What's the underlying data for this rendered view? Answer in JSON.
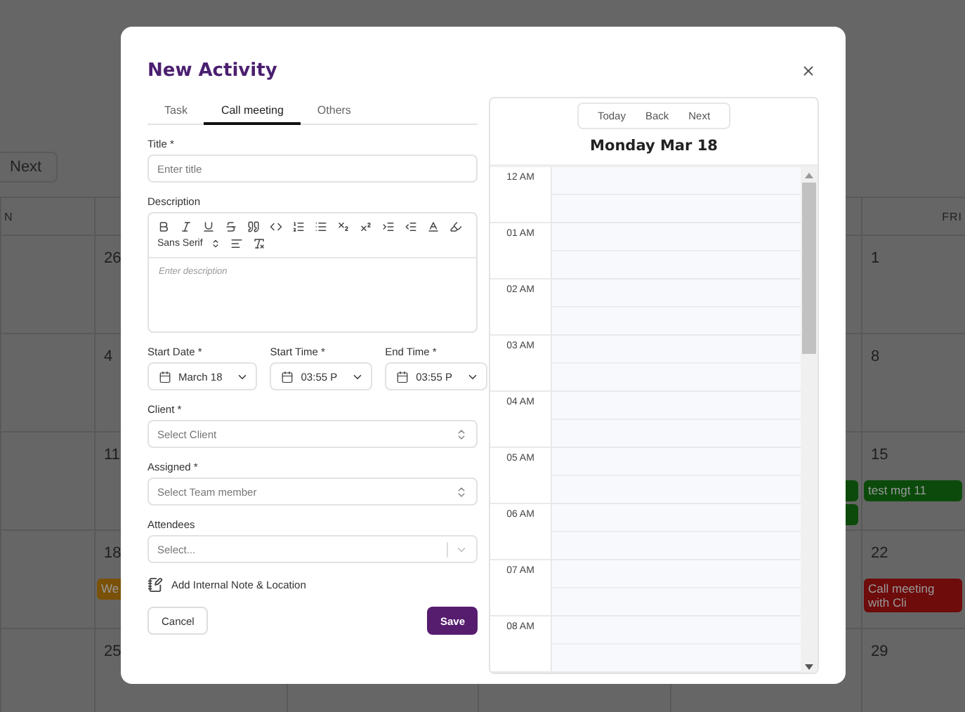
{
  "background_calendar": {
    "nav_button": "Next",
    "columns": [
      {
        "kind": "header_only",
        "header": "N"
      },
      {
        "kind": "days",
        "days": [
          {
            "kind": "day",
            "date": "26"
          },
          {
            "kind": "day",
            "date": "4"
          },
          {
            "kind": "day",
            "date": "11"
          },
          {
            "kind": "day",
            "date": "18",
            "events": [
              {
                "title": "We",
                "color": "#7a5108"
              }
            ]
          },
          {
            "kind": "day",
            "date": "25"
          }
        ]
      },
      {
        "kind": "covered"
      },
      {
        "kind": "covered"
      },
      {
        "kind": "days",
        "days": [
          {
            "kind": "blank"
          },
          {
            "kind": "blank"
          },
          {
            "kind": "day",
            "events": [
              {
                "color": "#0b4a0b"
              },
              {
                "color": "#0b4a0b"
              }
            ]
          },
          {
            "kind": "blank"
          },
          {
            "kind": "blank"
          }
        ]
      },
      {
        "kind": "days",
        "header": "FRI",
        "days": [
          {
            "kind": "day",
            "date": "1"
          },
          {
            "kind": "day",
            "date": "8"
          },
          {
            "kind": "day",
            "date": "15",
            "events": [
              {
                "title": "test mgt 11",
                "color": "#0b4a0b"
              }
            ]
          },
          {
            "kind": "day",
            "date": "22",
            "events": [
              {
                "title": "Call meeting with Cli",
                "color": "#6e0b0b"
              }
            ]
          },
          {
            "kind": "day",
            "date": "29"
          }
        ]
      }
    ]
  },
  "modal": {
    "title": "New Activity",
    "tabs": [
      {
        "label": "Task",
        "selected": false
      },
      {
        "label": "Call meeting",
        "selected": true
      },
      {
        "label": "Others",
        "selected": false
      }
    ],
    "title_field": {
      "label": "Title *",
      "placeholder": "Enter title"
    },
    "description": {
      "label": "Description",
      "font_picker": "Sans Serif",
      "placeholder": "Enter description"
    },
    "pickers": [
      {
        "label": "Start Date *",
        "value": "March 18"
      },
      {
        "label": "Start Time *",
        "value": "03:55 P"
      },
      {
        "label": "End Time *",
        "value": "03:55 P"
      }
    ],
    "selects": [
      {
        "kind": "updown",
        "label": "Client *",
        "placeholder": "Select Client"
      },
      {
        "kind": "updown",
        "label": "Assigned *",
        "placeholder": "Select Team member"
      },
      {
        "kind": "dropdown",
        "label": "Attendees",
        "placeholder": "Select..."
      }
    ],
    "note_link": "Add Internal Note & Location",
    "cancel": "Cancel",
    "save": "Save",
    "day_view": {
      "nav": [
        "Today",
        "Back",
        "Next"
      ],
      "title": "Monday Mar 18",
      "hours": [
        "12 AM",
        "01 AM",
        "02 AM",
        "03 AM",
        "04 AM",
        "05 AM",
        "06 AM",
        "07 AM",
        "08 AM"
      ]
    }
  }
}
